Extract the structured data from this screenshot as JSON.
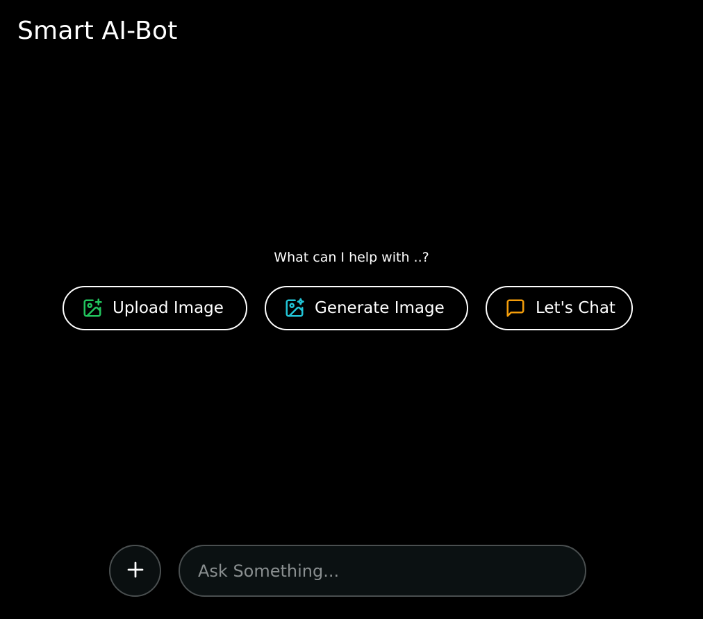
{
  "header": {
    "title": "Smart AI-Bot"
  },
  "main": {
    "prompt": "What can I help with ..?",
    "actions": [
      {
        "label": "Upload Image",
        "icon": "image-plus-icon",
        "color": "#22c55e"
      },
      {
        "label": "Generate Image",
        "icon": "image-sparkle-icon",
        "color": "#22c6d8"
      },
      {
        "label": "Let's Chat",
        "icon": "message-square-icon",
        "color": "#f59e0b"
      }
    ]
  },
  "composer": {
    "add_icon": "plus-icon",
    "placeholder": "Ask Something...",
    "value": ""
  }
}
